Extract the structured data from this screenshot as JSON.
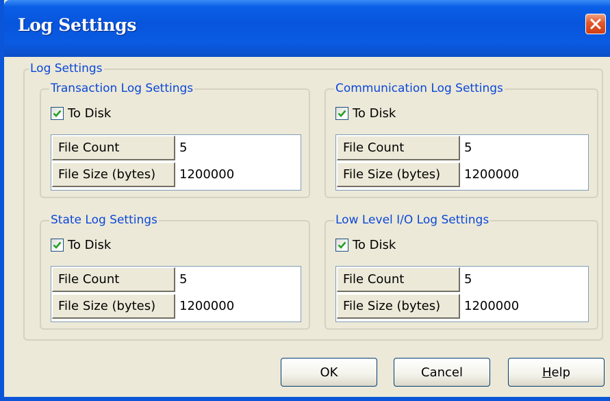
{
  "window": {
    "title": "Log Settings"
  },
  "main_group": {
    "label": "Log Settings"
  },
  "groups": [
    {
      "label": "Transaction Log Settings",
      "to_disk_label": "To Disk",
      "to_disk_checked": true,
      "rows": [
        {
          "key": "File Count",
          "value": "5"
        },
        {
          "key": "File Size (bytes)",
          "value": "1200000"
        }
      ]
    },
    {
      "label": "Communication Log Settings",
      "to_disk_label": "To Disk",
      "to_disk_checked": true,
      "rows": [
        {
          "key": "File Count",
          "value": "5"
        },
        {
          "key": "File Size (bytes)",
          "value": "1200000"
        }
      ]
    },
    {
      "label": "State Log Settings",
      "to_disk_label": "To Disk",
      "to_disk_checked": true,
      "rows": [
        {
          "key": "File Count",
          "value": "5"
        },
        {
          "key": "File Size (bytes)",
          "value": "1200000"
        }
      ]
    },
    {
      "label": "Low Level I/O Log Settings",
      "to_disk_label": "To Disk",
      "to_disk_checked": true,
      "rows": [
        {
          "key": "File Count",
          "value": "5"
        },
        {
          "key": "File Size (bytes)",
          "value": "1200000"
        }
      ]
    }
  ],
  "buttons": {
    "ok": "OK",
    "cancel": "Cancel",
    "help_first": "H",
    "help_rest": "elp"
  },
  "icons": {
    "close": "close-icon",
    "checkmark": "checkmark-icon"
  },
  "colors": {
    "titlebar": "#0a5ae2",
    "group_label": "#0b47d9",
    "close_button": "#e3562a",
    "checkmark": "#21a121"
  }
}
